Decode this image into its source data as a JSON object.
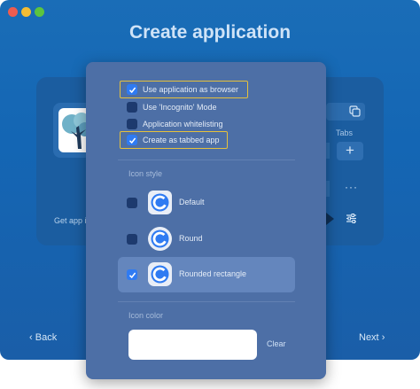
{
  "window": {
    "title": "Create application"
  },
  "background": {
    "get_app_label": "Get app ic",
    "tabs_label": "Tabs",
    "plus_label": "+",
    "more_label": "···",
    "back_label": "Back",
    "next_label": "Next"
  },
  "options": [
    {
      "label": "Use application as browser",
      "checked": true,
      "highlighted": true
    },
    {
      "label": "Use 'Incognito' Mode",
      "checked": false,
      "highlighted": false
    },
    {
      "label": "Application whitelisting",
      "checked": false,
      "highlighted": false
    },
    {
      "label": "Create as tabbed app",
      "checked": true,
      "highlighted": true
    }
  ],
  "icon_style": {
    "section_label": "Icon style",
    "items": [
      {
        "label": "Default",
        "checked": false,
        "selected": false,
        "shape": "square"
      },
      {
        "label": "Round",
        "checked": false,
        "selected": false,
        "shape": "circle"
      },
      {
        "label": "Rounded rectangle",
        "checked": true,
        "selected": true,
        "shape": "rounded-rectangle"
      }
    ]
  },
  "icon_color": {
    "section_label": "Icon color",
    "value": "#ffffff",
    "clear_label": "Clear"
  },
  "colors": {
    "accent": "#2f7bf2",
    "highlight": "#e6c13c",
    "popover": "#4d6fa6",
    "window": "#1a6db7"
  }
}
